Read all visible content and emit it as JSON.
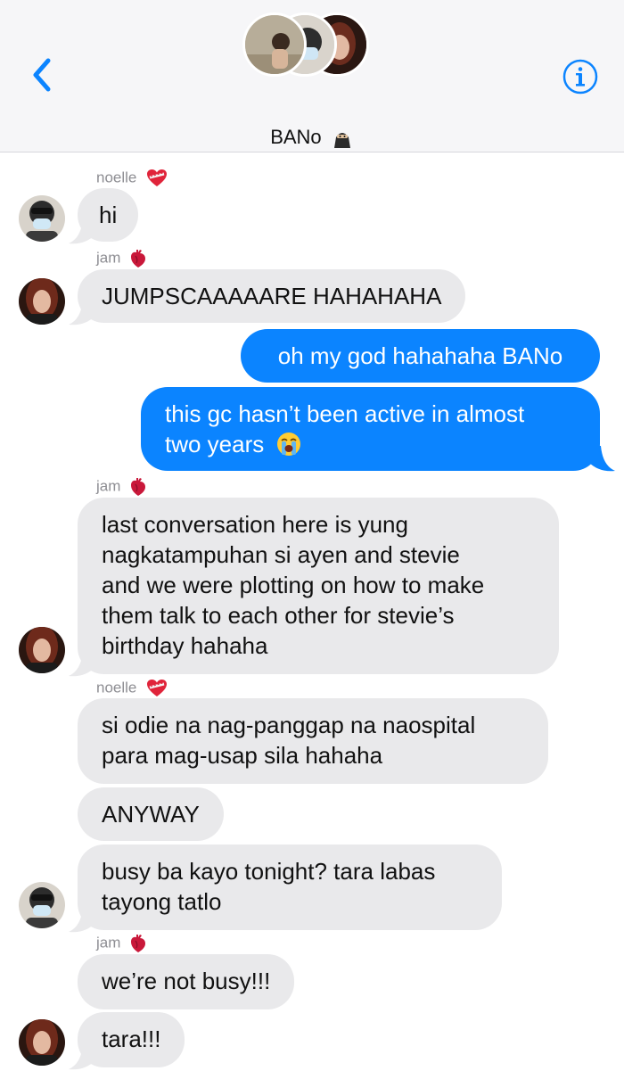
{
  "header": {
    "group_name": "BANo",
    "title_emoji": "ninja-emoji",
    "back_icon": "chevron-left-icon",
    "info_icon": "info-circle-icon",
    "accent_color": "#0b84ff"
  },
  "messages": [
    {
      "sender": "noelle",
      "sender_emoji": "mending-heart-emoji",
      "text": "hi",
      "type": "received"
    },
    {
      "sender": "jam",
      "sender_emoji": "anatomical-heart-emoji",
      "text": "JUMPSCAAAAARE HAHAHAHA",
      "type": "received"
    },
    {
      "text": "oh my god hahahaha BANo",
      "type": "sent"
    },
    {
      "line1": "this gc hasn’t been active in almost",
      "line2": "two years",
      "emoji": "loudly-crying-face-emoji",
      "type": "sent"
    },
    {
      "sender": "jam",
      "sender_emoji": "anatomical-heart-emoji",
      "lines": [
        "last conversation here is yung",
        "nagkatampuhan si ayen and stevie",
        "and we were plotting on how to make",
        "them talk to each other for stevie’s",
        "birthday hahaha"
      ],
      "type": "received"
    },
    {
      "sender": "noelle",
      "sender_emoji": "mending-heart-emoji",
      "lines": [
        "si odie na nag-panggap na naospital",
        "para mag-usap sila hahaha"
      ],
      "type": "received"
    },
    {
      "text": "ANYWAY",
      "type": "received"
    },
    {
      "lines": [
        "busy ba kayo tonight? tara labas",
        "tayong tatlo"
      ],
      "type": "received"
    },
    {
      "sender": "jam",
      "sender_emoji": "anatomical-heart-emoji",
      "text": "we’re not busy!!!",
      "type": "received"
    },
    {
      "text": "tara!!!",
      "type": "received"
    }
  ]
}
